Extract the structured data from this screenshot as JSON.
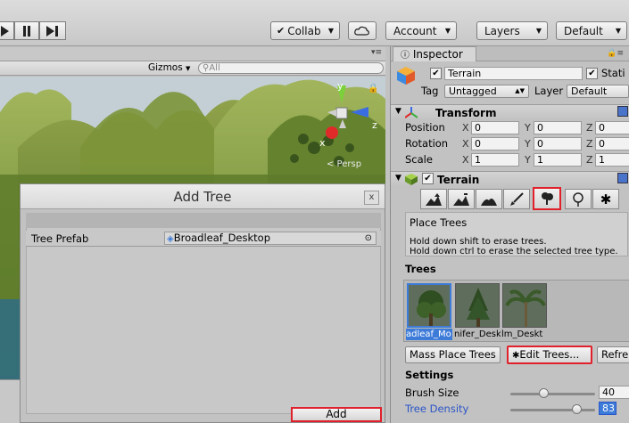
{
  "toolbar": {
    "collab_label": "Collab",
    "account_label": "Account",
    "layers_label": "Layers",
    "layout_label": "Default"
  },
  "scene": {
    "gizmos_label": "Gizmos",
    "search_placeholder": "All",
    "persp_label": "< Persp",
    "gizmo_axes": [
      "y",
      "z",
      "x"
    ]
  },
  "dialog": {
    "title": "Add Tree",
    "close_label": "x",
    "row_label": "Tree Prefab",
    "row_value": "Broadleaf_Desktop",
    "add_label": "Add"
  },
  "inspector": {
    "tab_label": "Inspector",
    "object_name": "Terrain",
    "static_label": "Stati",
    "tag_label": "Tag",
    "tag_value": "Untagged",
    "layer_label": "Layer",
    "layer_value": "Default",
    "transform": {
      "title": "Transform",
      "rows": [
        {
          "label": "Position",
          "x": "0",
          "y": "0",
          "z": "0"
        },
        {
          "label": "Rotation",
          "x": "0",
          "y": "0",
          "z": "0"
        },
        {
          "label": "Scale",
          "x": "1",
          "y": "1",
          "z": "1"
        }
      ],
      "axis_x": "X",
      "axis_y": "Y",
      "axis_z": "Z"
    },
    "terrain": {
      "title": "Terrain",
      "help_title": "Place Trees",
      "help_line1": "Hold down shift to erase trees.",
      "help_line2": "Hold down ctrl to erase the selected tree type.",
      "trees_header": "Trees",
      "trees": [
        {
          "label": "adleaf_Mo"
        },
        {
          "label": "nifer_Desk"
        },
        {
          "label": "lm_Deskt"
        }
      ],
      "mass_place_label": "Mass Place Trees",
      "edit_trees_label": "Edit Trees...",
      "refresh_label": "Refre",
      "settings_header": "Settings",
      "brush_size_label": "Brush Size",
      "brush_size_value": "40",
      "tree_density_label": "Tree Density",
      "tree_density_value": "83"
    }
  },
  "colors": {
    "highlight_red": "#e0202a",
    "selection_blue": "#3d7bd9",
    "link_blue": "#2b55c8"
  }
}
